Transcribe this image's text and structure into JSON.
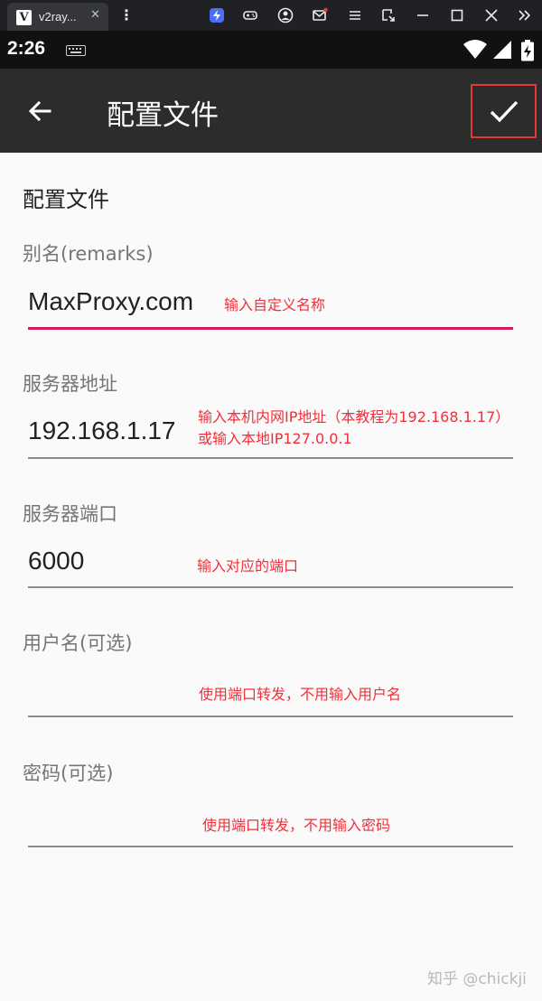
{
  "window": {
    "tab_title": "v2ray...",
    "tab_close": "✕",
    "app_icon_letter": "V",
    "kebab": "⋮"
  },
  "status_bar": {
    "time": "2:26"
  },
  "toolbar": {
    "title": "配置文件"
  },
  "form": {
    "section_title": "配置文件",
    "fields": [
      {
        "label": "别名(remarks)",
        "value": "MaxProxy.com",
        "note": "输入自定义名称"
      },
      {
        "label": "服务器地址",
        "value": "192.168.1.17",
        "note_line1": "输入本机内网IP地址（本教程为192.168.1.17）",
        "note_line2": "或输入本地IP127.0.0.1"
      },
      {
        "label": "服务器端口",
        "value": "6000",
        "note": "输入对应的端口"
      },
      {
        "label": "用户名(可选)",
        "value": "",
        "note": "使用端口转发，不用输入用户名"
      },
      {
        "label": "密码(可选)",
        "value": "",
        "note": "使用端口转发，不用输入密码"
      }
    ]
  },
  "watermark": "知乎 @chickji",
  "colors": {
    "accent_underline": "#d81b60",
    "annotation_red": "#f0303a",
    "toolbar_bg": "#2c2c2c"
  }
}
